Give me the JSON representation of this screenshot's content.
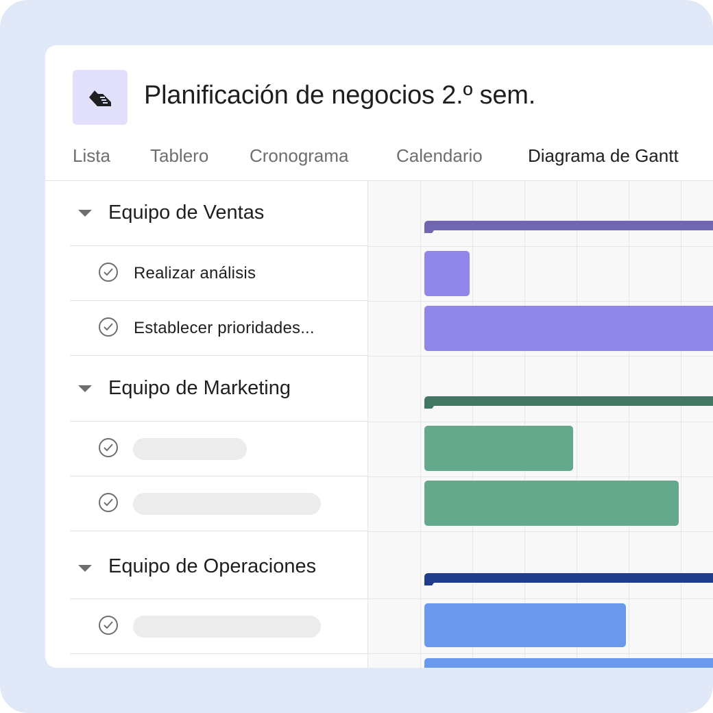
{
  "project": {
    "title": "Planificación de negocios 2.º sem.",
    "icon": "runner-shoe-icon"
  },
  "tabs": [
    {
      "label": "Lista",
      "active": false
    },
    {
      "label": "Tablero",
      "active": false
    },
    {
      "label": "Cronograma",
      "active": false
    },
    {
      "label": "Calendario",
      "active": false
    },
    {
      "label": "Diagrama de Gantt",
      "active": true
    }
  ],
  "groups": [
    {
      "label": "Equipo de Ventas",
      "color": "#7166b1",
      "tasks": [
        {
          "label": "Realizar análisis",
          "bar_color": "#9085e9"
        },
        {
          "label": "Establecer prioridades...",
          "bar_color": "#9085e9"
        }
      ]
    },
    {
      "label": "Equipo de Marketing",
      "color": "#427763",
      "tasks": [
        {
          "label": "",
          "bar_color": "#65a88b"
        },
        {
          "label": "",
          "bar_color": "#65a88b"
        }
      ]
    },
    {
      "label": "Equipo de Operaciones",
      "color": "#203d8c",
      "tasks": [
        {
          "label": "",
          "bar_color": "#6a98ec"
        },
        {
          "label": "",
          "bar_color": "#6a98ec"
        }
      ]
    }
  ],
  "colors": {
    "background": "#e1e9f9",
    "icon_tile": "#e3e0fb"
  }
}
